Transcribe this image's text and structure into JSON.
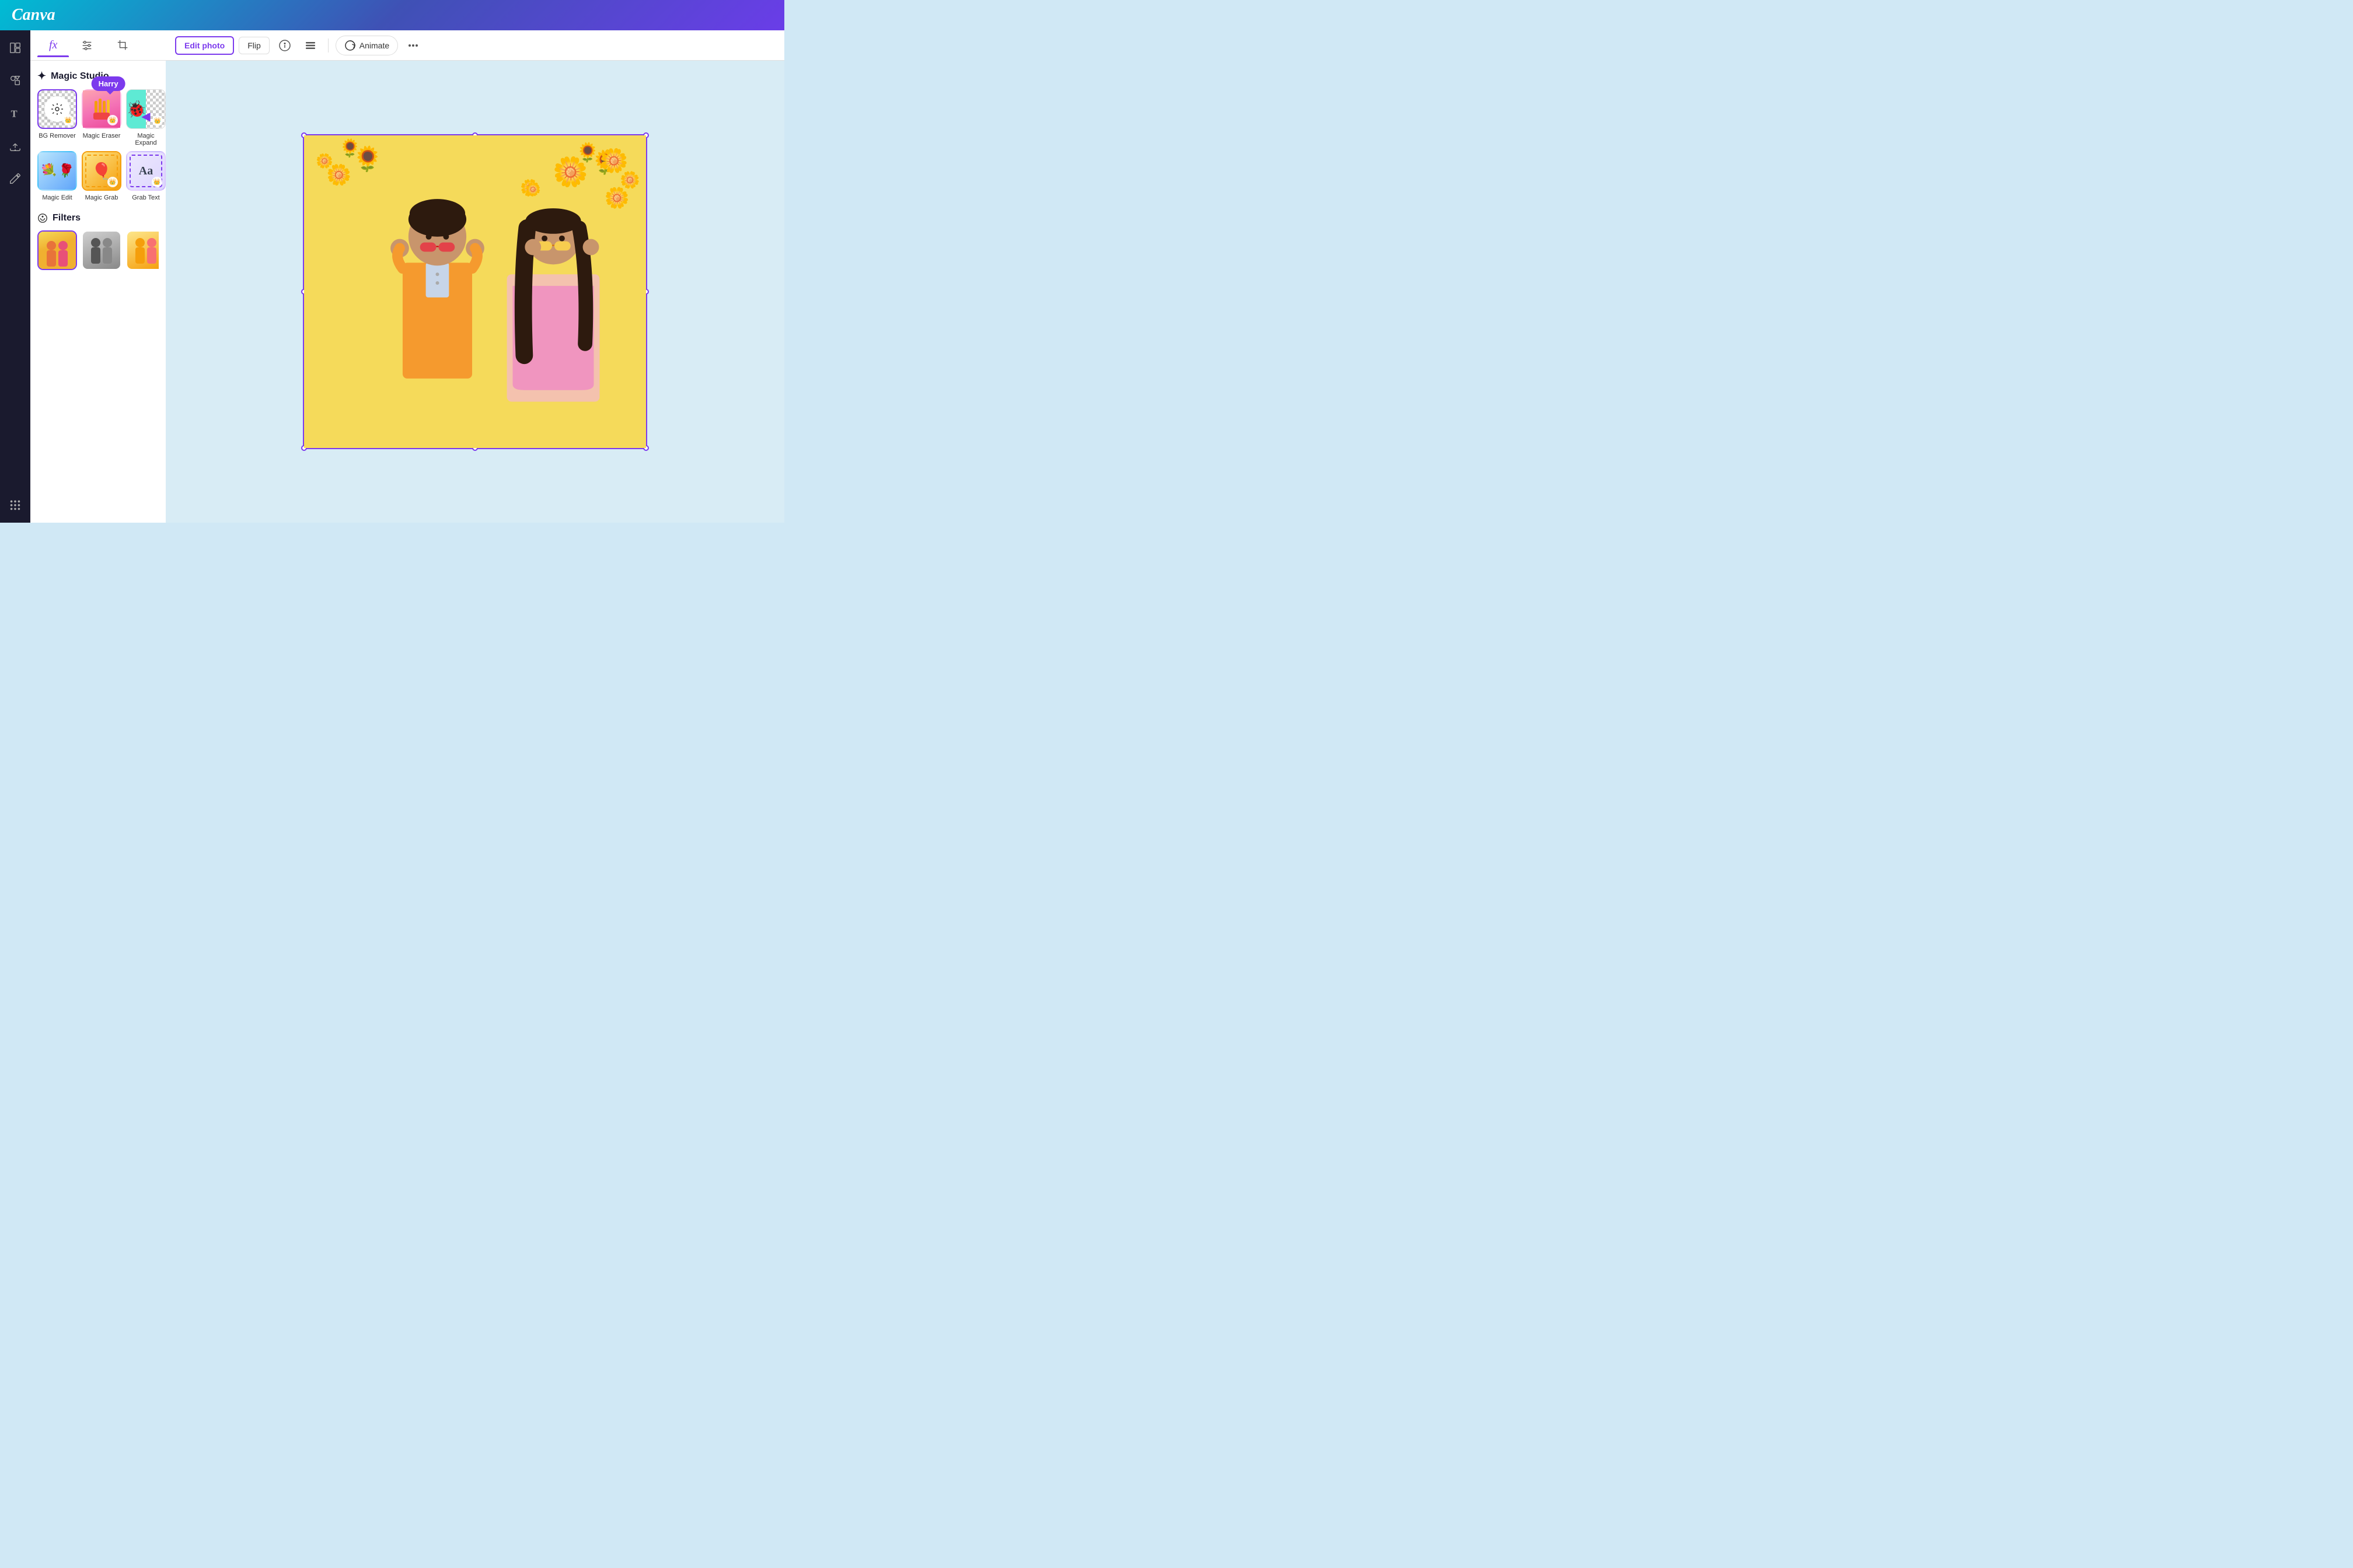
{
  "app": {
    "title": "Canva"
  },
  "header": {
    "logo": "Canva"
  },
  "panel": {
    "tabs": [
      {
        "id": "effects",
        "label": "fx",
        "active": true
      },
      {
        "id": "adjust",
        "label": "⊟"
      },
      {
        "id": "crop",
        "label": "⊡"
      }
    ],
    "magic_studio": {
      "section_label": "Magic Studio",
      "icon": "✦",
      "tools": [
        {
          "id": "bg-remover",
          "label": "BG Remover",
          "active": true,
          "has_crown": true,
          "tooltip": null
        },
        {
          "id": "magic-eraser",
          "label": "Magic Eraser",
          "active": false,
          "has_crown": true,
          "tooltip": "Harry"
        },
        {
          "id": "magic-expand",
          "label": "Magic Expand",
          "active": false,
          "has_crown": true,
          "tooltip": null
        },
        {
          "id": "magic-edit",
          "label": "Magic Edit",
          "active": false,
          "has_crown": false,
          "tooltip": null
        },
        {
          "id": "magic-grab",
          "label": "Magic Grab",
          "active": false,
          "has_crown": true,
          "tooltip": null
        },
        {
          "id": "grab-text",
          "label": "Grab Text",
          "active": false,
          "has_crown": true,
          "tooltip": null
        }
      ]
    },
    "filters": {
      "section_label": "Filters",
      "icon": "⊙",
      "items": [
        {
          "id": "filter-original",
          "label": "",
          "active": true
        },
        {
          "id": "filter-bw",
          "label": "",
          "active": false
        },
        {
          "id": "filter-warm",
          "label": "",
          "active": false
        }
      ]
    }
  },
  "toolbar": {
    "edit_photo_label": "Edit photo",
    "flip_label": "Flip",
    "info_label": "",
    "menu_label": "",
    "animate_label": "Animate",
    "more_label": "..."
  },
  "sidebar": {
    "icons": [
      {
        "id": "templates",
        "symbol": "▣"
      },
      {
        "id": "elements",
        "symbol": "◈"
      },
      {
        "id": "text",
        "symbol": "T"
      },
      {
        "id": "upload",
        "symbol": "↑"
      },
      {
        "id": "draw",
        "symbol": "✏"
      },
      {
        "id": "apps",
        "symbol": "⊞"
      }
    ]
  }
}
